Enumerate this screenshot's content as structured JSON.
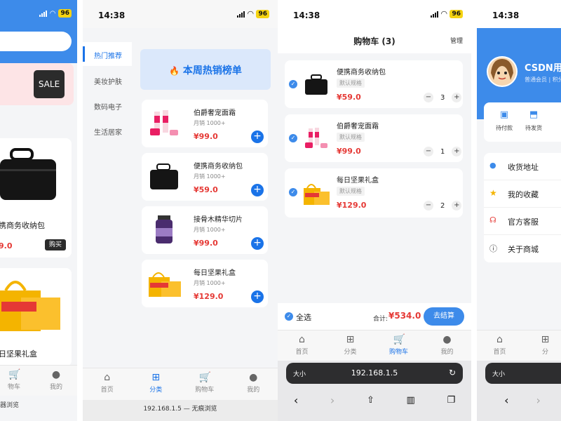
{
  "status": {
    "time": "14:38",
    "battery": "96"
  },
  "p1": {
    "sale_label": "SALE",
    "product1_name": "携商务收纳包",
    "product1_price": "9.0",
    "buy_label": "购买",
    "product2_name": "日坚果礼盒",
    "tabs": [
      "物车",
      "我的"
    ],
    "footer": "器浏览"
  },
  "p2": {
    "categories": [
      "热门推荐",
      "美妆护肤",
      "数码电子",
      "生活居家"
    ],
    "banner_title": "本周热销榜单",
    "products": [
      {
        "name": "伯爵奢宠面霜",
        "sales": "月销 1000+",
        "price": "¥99.0"
      },
      {
        "name": "便携商务收纳包",
        "sales": "月销 1000+",
        "price": "¥59.0"
      },
      {
        "name": "接骨木精华切片",
        "sales": "月销 1000+",
        "price": "¥99.0"
      },
      {
        "name": "每日坚果礼盒",
        "sales": "月销 1000+",
        "price": "¥129.0"
      }
    ],
    "tabs": [
      "首页",
      "分类",
      "购物车",
      "我的"
    ],
    "footer": "192.168.1.5 — 无痕浏览"
  },
  "p3": {
    "title": "购物车 (3)",
    "manage": "管理",
    "items": [
      {
        "name": "便携商务收纳包",
        "spec": "默认规格",
        "price": "¥59.0",
        "qty": "3"
      },
      {
        "name": "伯爵奢宠面霜",
        "spec": "默认规格",
        "price": "¥99.0",
        "qty": "1"
      },
      {
        "name": "每日坚果礼盒",
        "spec": "默认规格",
        "price": "¥129.0",
        "qty": "2"
      }
    ],
    "select_all": "全选",
    "total_label": "合计:",
    "total_value": "¥534.0",
    "checkout": "去结算",
    "tabs": [
      "首页",
      "分类",
      "购物车",
      "我的"
    ],
    "url_size": "大小",
    "url": "192.168.1.5"
  },
  "p4": {
    "user_name": "CSDN用户",
    "member": "普通会员 | 积分",
    "order_items": [
      "待付款",
      "待发货"
    ],
    "menu": [
      "收货地址",
      "我的收藏",
      "官方客服",
      "关于商城"
    ],
    "tabs": [
      "首页",
      "分"
    ],
    "url_size": "大小"
  },
  "colors": {
    "accent": "#1a73e8",
    "price": "#e53935",
    "header_blue": "#3d8bea"
  }
}
